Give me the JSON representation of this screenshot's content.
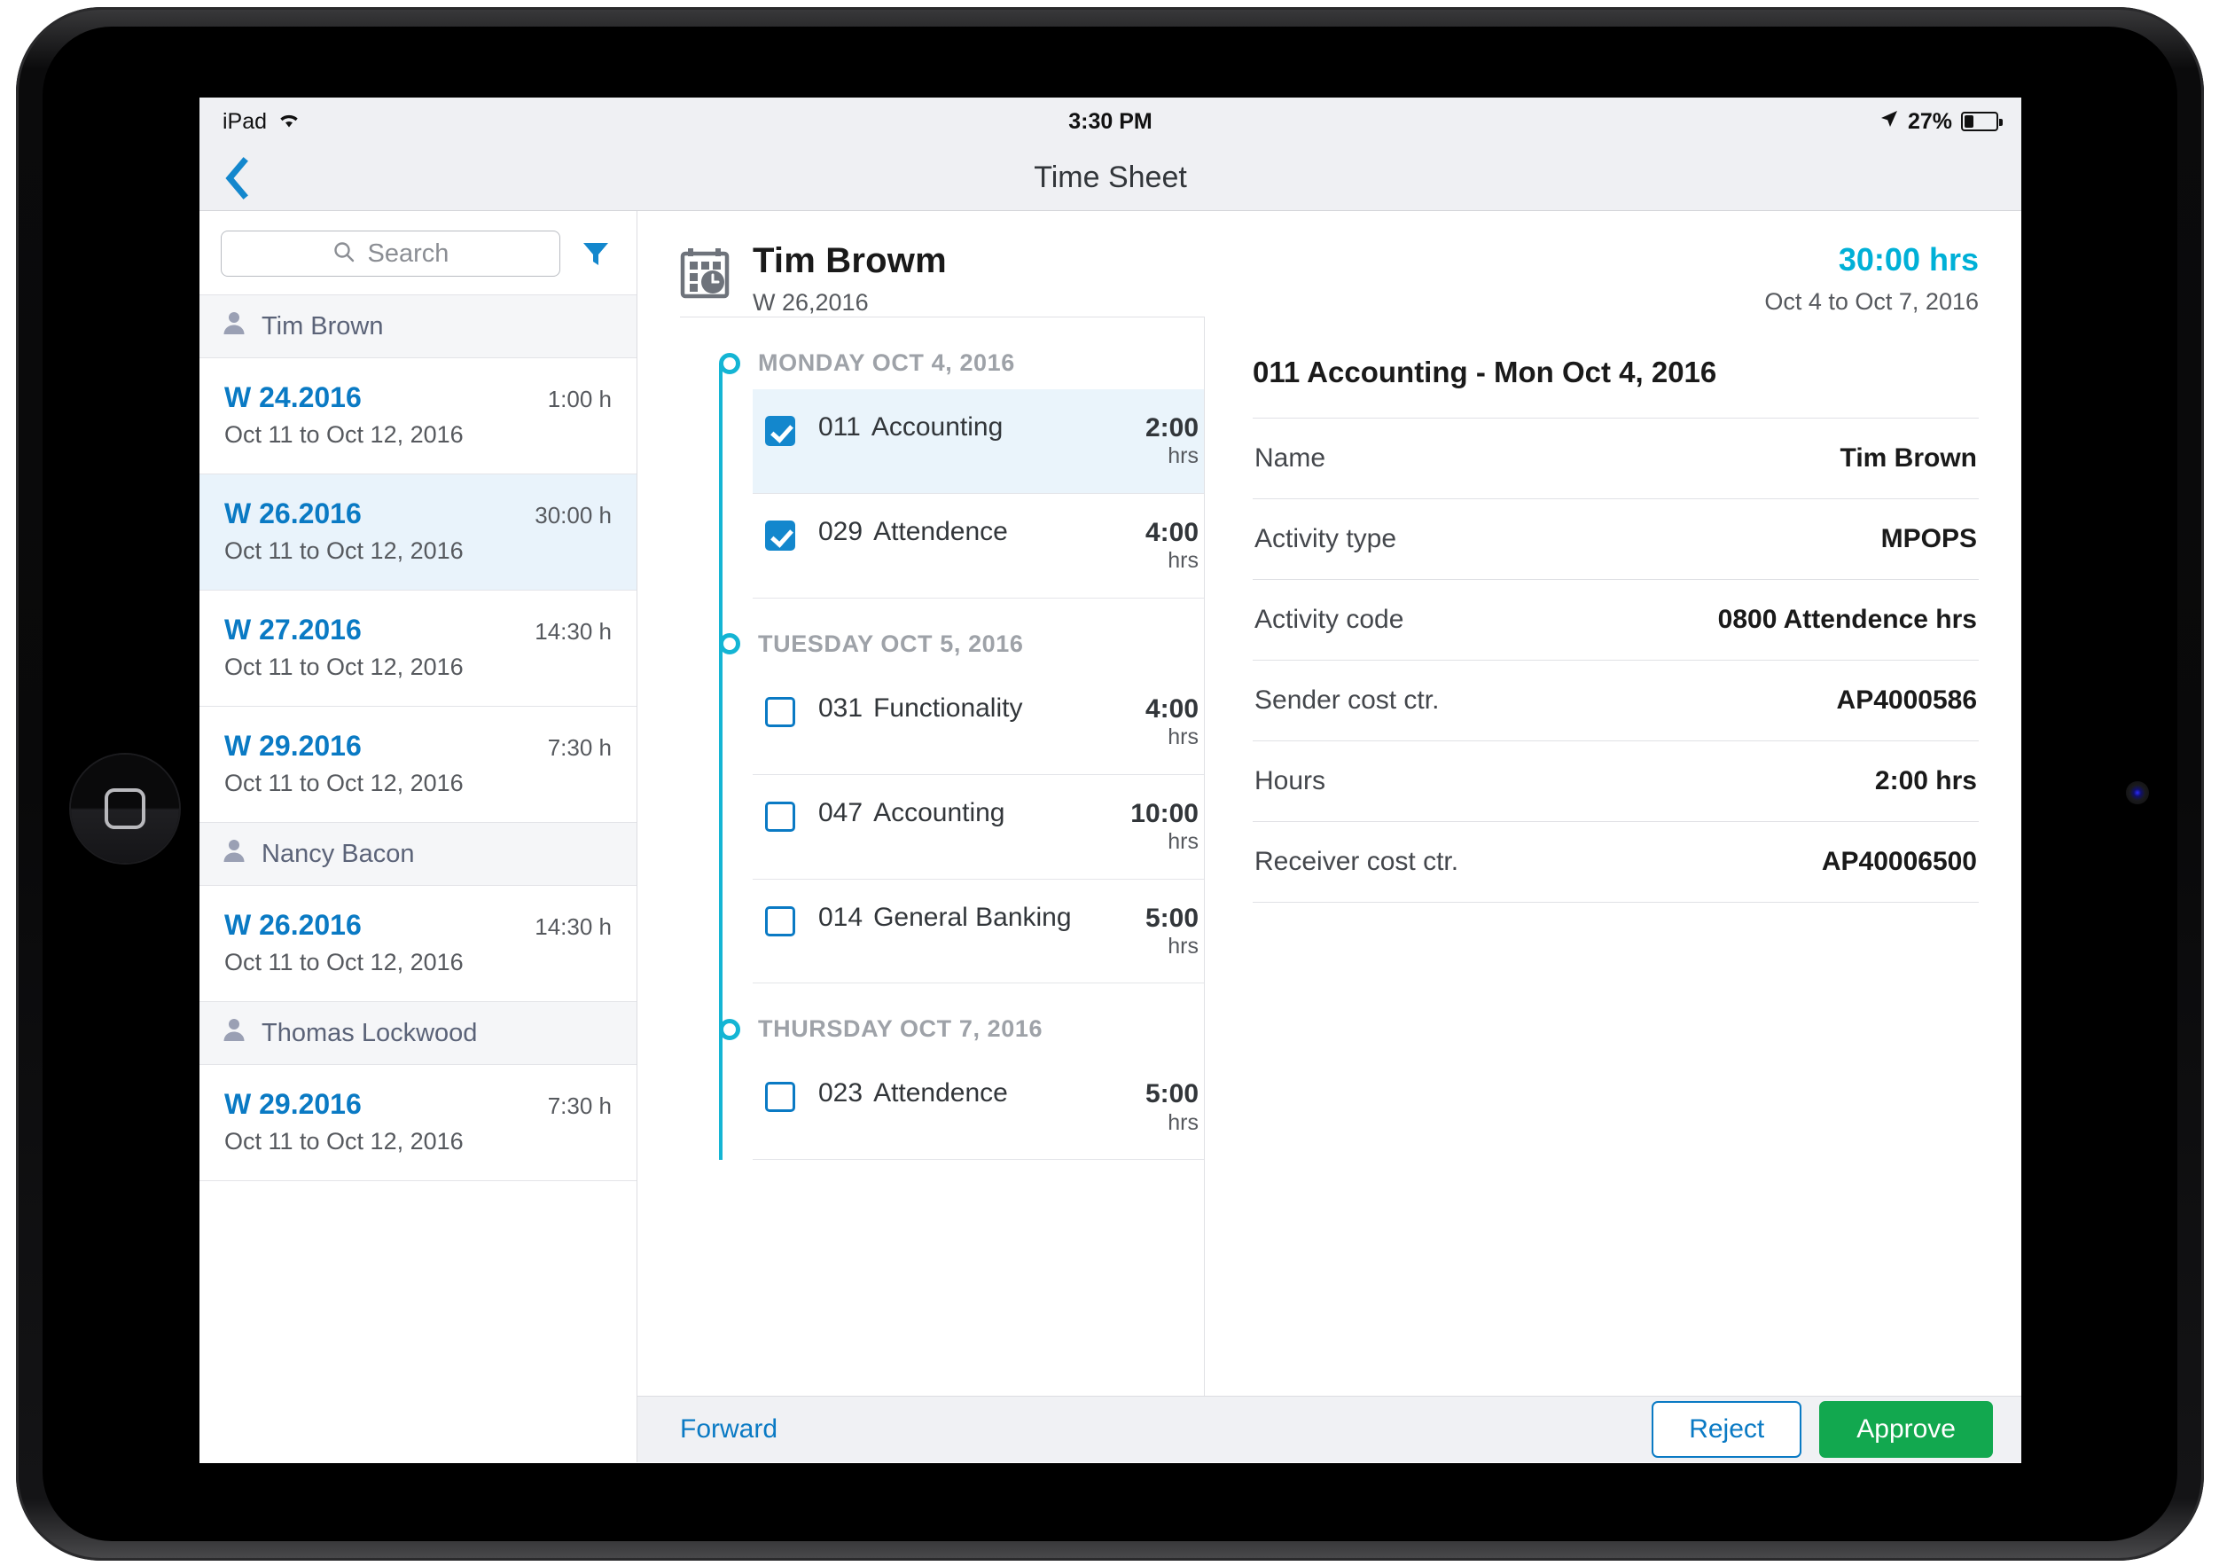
{
  "status_bar": {
    "carrier": "iPad",
    "wifi_icon": "wifi-icon",
    "time": "3:30 PM",
    "location_icon": "location-arrow-icon",
    "battery_percent": "27%"
  },
  "nav": {
    "back_icon": "chevron-left-icon",
    "title": "Time Sheet"
  },
  "sidebar": {
    "search": {
      "placeholder": "Search",
      "value": "",
      "icon": "search-icon"
    },
    "filter_icon": "filter-icon",
    "groups": [
      {
        "person": "Tim Brown",
        "avatar_icon": "person-icon",
        "timesheets": [
          {
            "week": "W 24.2016",
            "hours": "1:00 h",
            "range": "Oct 11 to Oct 12, 2016",
            "selected": false
          },
          {
            "week": "W 26.2016",
            "hours": "30:00 h",
            "range": "Oct 11 to Oct 12, 2016",
            "selected": true
          },
          {
            "week": "W 27.2016",
            "hours": "14:30 h",
            "range": "Oct 11 to Oct 12, 2016",
            "selected": false
          },
          {
            "week": "W 29.2016",
            "hours": "7:30 h",
            "range": "Oct 11 to Oct 12, 2016",
            "selected": false
          }
        ]
      },
      {
        "person": "Nancy Bacon",
        "avatar_icon": "person-icon",
        "timesheets": [
          {
            "week": "W 26.2016",
            "hours": "14:30 h",
            "range": "Oct 11 to Oct 12, 2016",
            "selected": false
          }
        ]
      },
      {
        "person": "Thomas Lockwood",
        "avatar_icon": "person-icon",
        "timesheets": [
          {
            "week": "W 29.2016",
            "hours": "7:30 h",
            "range": "Oct 11 to Oct 12, 2016",
            "selected": false
          }
        ]
      }
    ]
  },
  "main_header": {
    "calendar_icon": "calendar-clock-icon",
    "name": "Tim Browm",
    "week": "W 26,2016",
    "total_hours": "30:00 hrs",
    "date_range": "Oct 4 to Oct 7, 2016"
  },
  "timeline": {
    "days": [
      {
        "label": "MONDAY OCT 4, 2016",
        "entries": [
          {
            "code": "011",
            "name": "Accounting",
            "hours": "2:00",
            "unit": "hrs",
            "checked": true,
            "selected": true
          },
          {
            "code": "029",
            "name": "Attendence",
            "hours": "4:00",
            "unit": "hrs",
            "checked": true,
            "selected": false
          }
        ]
      },
      {
        "label": "TUESDAY OCT 5, 2016",
        "entries": [
          {
            "code": "031",
            "name": "Functionality",
            "hours": "4:00",
            "unit": "hrs",
            "checked": false,
            "selected": false
          },
          {
            "code": "047",
            "name": "Accounting",
            "hours": "10:00",
            "unit": "hrs",
            "checked": false,
            "selected": false
          },
          {
            "code": "014",
            "name": "General Banking",
            "hours": "5:00",
            "unit": "hrs",
            "checked": false,
            "selected": false
          }
        ]
      },
      {
        "label": "THURSDAY OCT 7, 2016",
        "entries": [
          {
            "code": "023",
            "name": "Attendence",
            "hours": "5:00",
            "unit": "hrs",
            "checked": false,
            "selected": false
          }
        ]
      }
    ]
  },
  "detail": {
    "title": "011 Accounting - Mon Oct 4, 2016",
    "rows": [
      {
        "key": "Name",
        "value": "Tim Brown"
      },
      {
        "key": "Activity type",
        "value": "MPOPS"
      },
      {
        "key": "Activity code",
        "value": "0800 Attendence hrs"
      },
      {
        "key": "Sender cost ctr.",
        "value": "AP4000586"
      },
      {
        "key": "Hours",
        "value": "2:00 hrs"
      },
      {
        "key": "Receiver cost ctr.",
        "value": "AP40006500"
      }
    ]
  },
  "footer": {
    "forward_label": "Forward",
    "reject_label": "Reject",
    "approve_label": "Approve"
  },
  "colors": {
    "accent_blue": "#0a7ac4",
    "teal": "#14b5d4",
    "approve_green": "#12a84f",
    "selected_row": "#e9f3fb"
  }
}
